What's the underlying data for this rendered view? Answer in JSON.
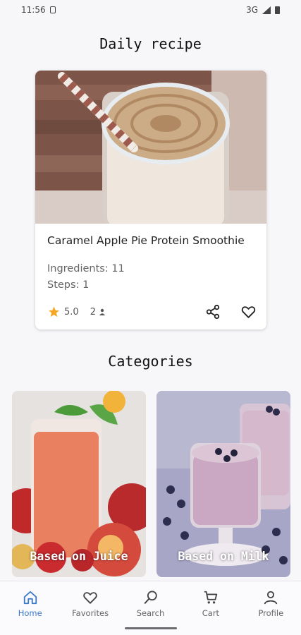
{
  "status_bar": {
    "time": "11:56",
    "network": "3G"
  },
  "daily": {
    "section_title": "Daily recipe",
    "recipe": {
      "name": "Caramel Apple Pie Protein Smoothie",
      "ingredients_text": "Ingredients: 11",
      "steps_text": "Steps: 1",
      "rating": "5.0",
      "users": "2"
    }
  },
  "categories": {
    "section_title": "Categories",
    "items": [
      {
        "label": "Based on Juice"
      },
      {
        "label": "Based on Milk"
      }
    ]
  },
  "nav": {
    "items": [
      {
        "label": "Home",
        "icon": "home-icon",
        "active": true
      },
      {
        "label": "Favorites",
        "icon": "heart-icon",
        "active": false
      },
      {
        "label": "Search",
        "icon": "search-icon",
        "active": false
      },
      {
        "label": "Cart",
        "icon": "cart-icon",
        "active": false
      },
      {
        "label": "Profile",
        "icon": "profile-icon",
        "active": false
      }
    ]
  },
  "colors": {
    "accent": "#3c7ac9",
    "star": "#f5a623",
    "background": "#f7f6f9"
  }
}
